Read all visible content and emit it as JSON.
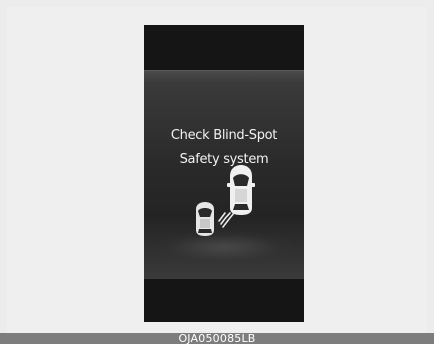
{
  "display": {
    "message_line1": "Check Blind-Spot",
    "message_line2": "Safety system",
    "icon_cars": "blind-spot-two-cars-icon",
    "icon_sensor_waves": "sensor-wave-icon"
  },
  "footer": {
    "image_code": "OJA050085LB"
  },
  "colors": {
    "page_background": "#ececec",
    "display_background": "#1a1a1a",
    "text": "#f2f2f2",
    "footer_bar": "#7d7d7d"
  }
}
